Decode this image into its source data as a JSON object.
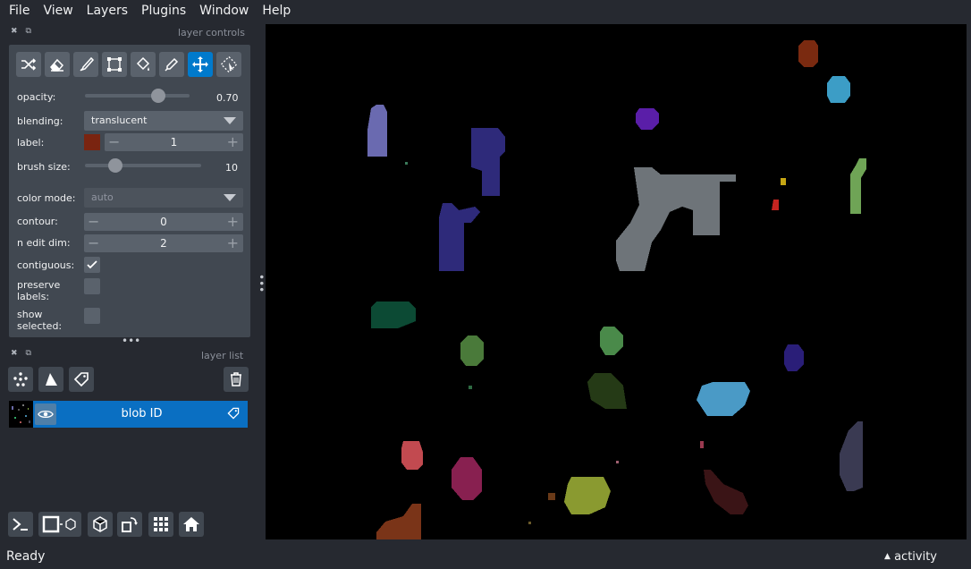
{
  "menubar": {
    "items": [
      "File",
      "View",
      "Layers",
      "Plugins",
      "Window",
      "Help"
    ]
  },
  "layer_controls": {
    "header": "layer controls",
    "tools": [
      "shuffle-icon",
      "eraser-icon",
      "paintbrush-icon",
      "polygon-select-icon",
      "fill-bucket-icon",
      "color-picker-icon",
      "move-icon",
      "transform-icon"
    ],
    "active_tool": "move-icon",
    "opacity_label": "opacity:",
    "opacity_value": "0.70",
    "opacity": 0.7,
    "blending_label": "blending:",
    "blending_value": "translucent",
    "label_label": "label:",
    "label_value": "1",
    "label_color": "#7a2410",
    "brush_size_label": "brush size:",
    "brush_size_value": "10",
    "color_mode_label": "color mode:",
    "color_mode_value": "auto",
    "contour_label": "contour:",
    "contour_value": "0",
    "n_edit_dim_label": "n edit dim:",
    "n_edit_dim_value": "2",
    "contiguous_label": "contiguous:",
    "contiguous_checked": true,
    "preserve_labels_label_1": "preserve",
    "preserve_labels_label_2": "labels:",
    "preserve_labels_checked": false,
    "show_selected_label_1": "show",
    "show_selected_label_2": "selected:",
    "show_selected_checked": false
  },
  "layer_list": {
    "header": "layer list",
    "buttons": [
      "points-icon",
      "shapes-icon",
      "labels-icon"
    ],
    "layers": [
      {
        "name": "blob ID",
        "visible": true,
        "selected": true
      }
    ]
  },
  "bottom_toolbar": [
    "console-icon",
    "ndisplay-2d-icon",
    "3d-cube-icon",
    "transpose-icon",
    "grid-icon",
    "home-icon"
  ],
  "statusbar": {
    "status": "Ready",
    "activity": "activity"
  },
  "colors": {
    "accent": "#007acc",
    "background": "#262930",
    "panel": "#414851",
    "selected_layer": "#0a6fc2"
  }
}
